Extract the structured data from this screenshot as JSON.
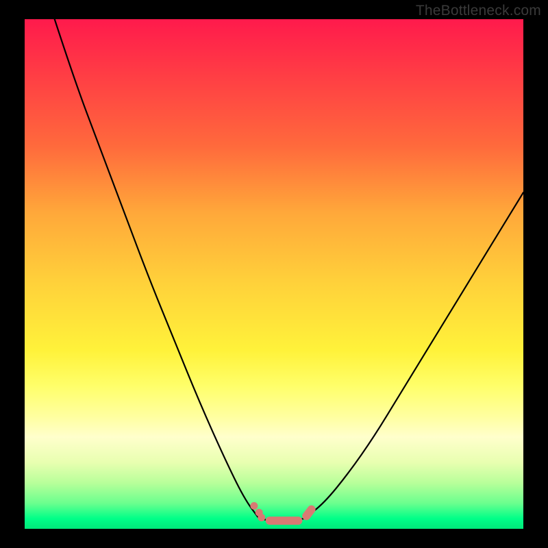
{
  "watermark": "TheBottleneck.com",
  "chart_data": {
    "type": "line",
    "title": "",
    "xlabel": "",
    "ylabel": "",
    "xlim": [
      0,
      100
    ],
    "ylim": [
      0,
      100
    ],
    "grid": false,
    "legend": false,
    "series": [
      {
        "name": "left-branch",
        "x": [
          6,
          10,
          15,
          20,
          25,
          30,
          35,
          40,
          44,
          47
        ],
        "y": [
          100,
          88,
          75,
          62,
          49,
          37,
          25,
          14,
          6,
          2
        ]
      },
      {
        "name": "bottom-flat",
        "x": [
          47,
          50,
          53,
          56
        ],
        "y": [
          2,
          1.5,
          1.5,
          2
        ]
      },
      {
        "name": "right-branch",
        "x": [
          56,
          60,
          65,
          70,
          75,
          80,
          85,
          90,
          95,
          100
        ],
        "y": [
          2,
          5,
          11,
          18,
          26,
          34,
          42,
          50,
          58,
          66
        ]
      }
    ],
    "markers": [
      {
        "x": 46,
        "y": 4.5,
        "type": "dot"
      },
      {
        "x": 47,
        "y": 3.2,
        "type": "dot"
      },
      {
        "x": 47.5,
        "y": 2.2,
        "type": "dot"
      },
      {
        "x": 49,
        "y": 1.6,
        "type": "pill_start"
      },
      {
        "x": 55,
        "y": 1.6,
        "type": "pill_end"
      },
      {
        "x": 56.5,
        "y": 2.5,
        "type": "pill2_start"
      },
      {
        "x": 57.5,
        "y": 3.8,
        "type": "pill2_end"
      }
    ],
    "background_gradient": {
      "stops": [
        {
          "pos": 0,
          "color": "#ff1a4c"
        },
        {
          "pos": 25,
          "color": "#ff6a3c"
        },
        {
          "pos": 52,
          "color": "#ffd23a"
        },
        {
          "pos": 78,
          "color": "#ffffa0"
        },
        {
          "pos": 95,
          "color": "#6aff8e"
        },
        {
          "pos": 100,
          "color": "#00e87a"
        }
      ]
    }
  }
}
